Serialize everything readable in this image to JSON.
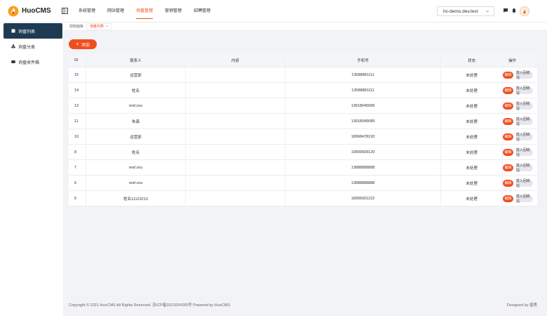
{
  "header": {
    "logo_text": "HuoCMS",
    "nav": [
      {
        "label": "系统管理",
        "active": false
      },
      {
        "label": "网站管理",
        "active": false
      },
      {
        "label": "询盘管理",
        "active": true
      },
      {
        "label": "营销管理",
        "active": false
      },
      {
        "label": "招聘管理",
        "active": false
      }
    ],
    "domain_select": {
      "value": "hc-demo.dev.test"
    },
    "icons": [
      "menu-toggle-icon",
      "message-icon",
      "bell-icon",
      "avatar"
    ],
    "accent_color": "#f04e1e"
  },
  "sidebar": {
    "items": [
      {
        "label": "询盘列表",
        "active": true,
        "icon": "file-icon"
      },
      {
        "label": "询盘分类",
        "active": false,
        "icon": "category-icon"
      },
      {
        "label": "询盘收件箱",
        "active": false,
        "icon": "inbox-icon"
      }
    ],
    "active_color": "#1f3b54"
  },
  "breadcrumb": {
    "items": [
      "控制面板",
      "询盘列表"
    ],
    "close": "×"
  },
  "toolbar": {
    "add_label": "添加"
  },
  "table": {
    "columns": [
      "ID",
      "联系人",
      "内容",
      "手机号",
      "状态",
      "操作"
    ],
    "rows": [
      {
        "id": "15",
        "contact": "运营部",
        "content": "",
        "phone": "13588881111",
        "status": "未处理"
      },
      {
        "id": "14",
        "contact": "姓名",
        "content": "",
        "phone": "13588881111",
        "status": "未处理"
      },
      {
        "id": "13",
        "contact": "reid zou",
        "content": "",
        "phone": "13918045689",
        "status": "未处理"
      },
      {
        "id": "11",
        "contact": "朱森",
        "content": "",
        "phone": "13918045689",
        "status": "未处理"
      },
      {
        "id": "10",
        "contact": "运营部",
        "content": "",
        "phone": "18068478193",
        "status": "未处理"
      },
      {
        "id": "8",
        "contact": "姓名",
        "content": "",
        "phone": "19909609120",
        "status": "未处理"
      },
      {
        "id": "7",
        "contact": "reid zou",
        "content": "",
        "phone": "13888888888",
        "status": "未处理"
      },
      {
        "id": "6",
        "contact": "reid zou",
        "content": "",
        "phone": "13888888888",
        "status": "未处理"
      },
      {
        "id": "5",
        "contact": "姓名11123213",
        "content": "",
        "phone": "18365001222",
        "status": "未处理"
      }
    ],
    "edit_label": "编辑",
    "trash_label": "放入回收站"
  },
  "footer": {
    "left": "Copyright © 2021 HuoCMS All Rights Reserved. 苏ICP备2021024265号 Powered by HuoCMS",
    "right": "Designed by 盛质"
  }
}
